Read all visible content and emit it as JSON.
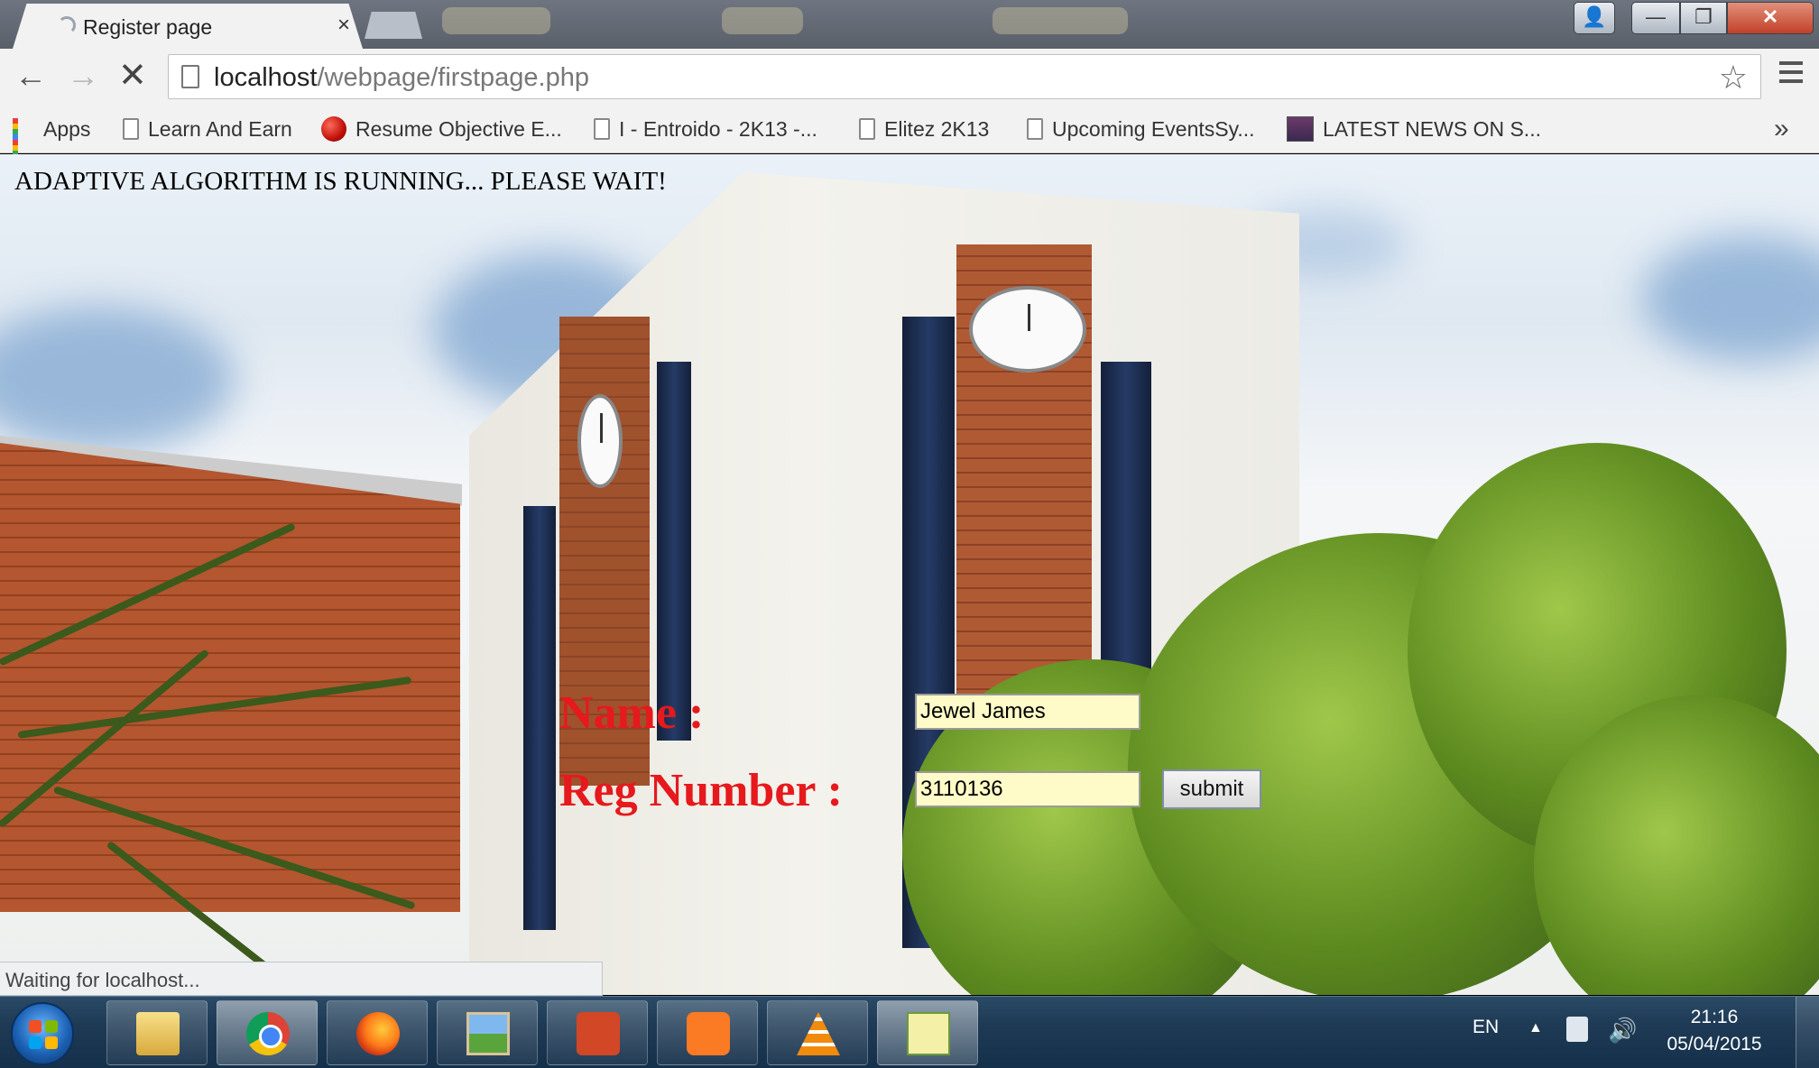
{
  "browser": {
    "tab_title": "Register page",
    "tab_close": "×",
    "window_controls": {
      "user": "👤",
      "minimize": "—",
      "maximize": "❐",
      "close": "✕"
    },
    "nav": {
      "back": "←",
      "forward": "→",
      "stop": "✕"
    },
    "url_host": "localhost",
    "url_path": "/webpage/firstpage.php",
    "star": "☆",
    "bookmarks": [
      {
        "label": "Apps",
        "icon": "apps-grid-icon"
      },
      {
        "label": "Learn And Earn",
        "icon": "page-icon"
      },
      {
        "label": "Resume Objective E...",
        "icon": "red-ball-icon"
      },
      {
        "label": "I - Entroido - 2K13 -...",
        "icon": "page-icon"
      },
      {
        "label": "Elitez 2K13",
        "icon": "page-icon"
      },
      {
        "label": "Upcoming EventsSy...",
        "icon": "page-icon"
      },
      {
        "label": "LATEST NEWS ON S...",
        "icon": "news-thumbnail-icon"
      }
    ],
    "bookmarks_more": "»",
    "status_text": "Waiting for localhost..."
  },
  "page": {
    "running_message": "ADAPTIVE ALGORITHM IS RUNNING... PLEASE WAIT!",
    "name_label": "Name :",
    "name_value": "Jewel James",
    "reg_label": "Reg Number :",
    "reg_value": "3110136",
    "submit_label": "submit"
  },
  "taskbar": {
    "apps": [
      "windows-explorer",
      "google-chrome",
      "firefox",
      "photo-viewer",
      "powerpoint",
      "xampp",
      "vlc",
      "notepad-plus-plus"
    ],
    "language": "EN",
    "tray_arrow": "▲",
    "volume": "🔊",
    "time": "21:16",
    "date": "05/04/2015"
  },
  "colors": {
    "form_label": "#e6191d",
    "input_background": "#fffbc8",
    "taskbar": "#1e3a55"
  }
}
